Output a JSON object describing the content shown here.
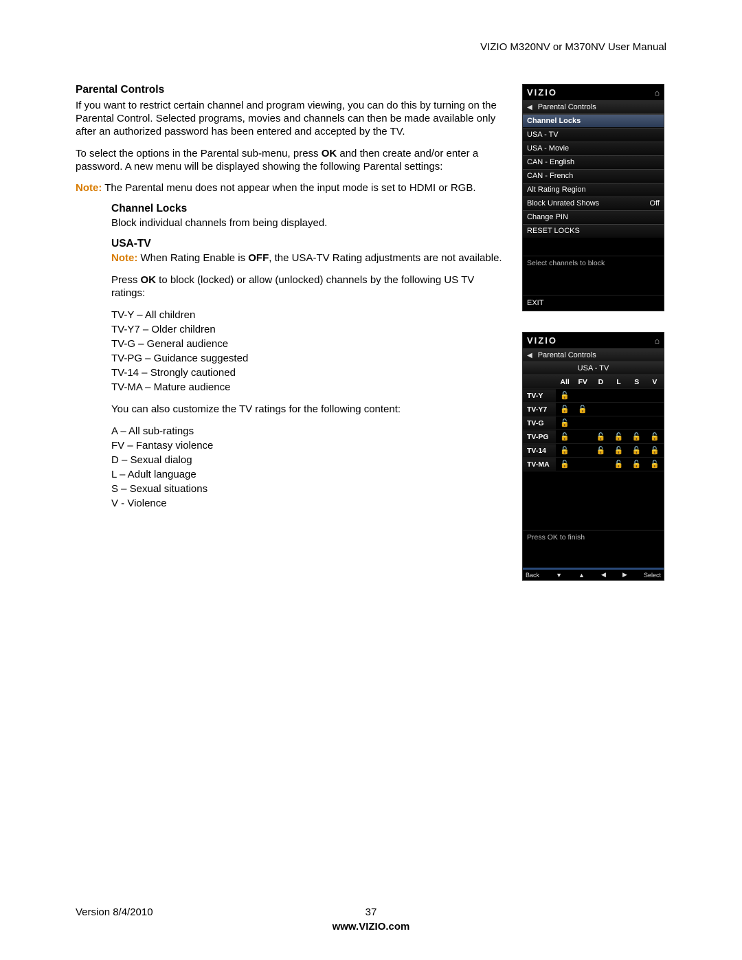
{
  "header": {
    "right": "VIZIO M320NV or M370NV User Manual"
  },
  "sections": {
    "title": "Parental Controls",
    "intro": "If you want to restrict certain channel and program viewing, you can do this by turning on the Parental Control. Selected programs, movies and channels can then be made available only after an authorized password has been entered and accepted by the TV.",
    "p2a": "To select the options in the Parental sub-menu, press ",
    "p2b": " and then create and/or enter a password. A new menu will be displayed showing the following Parental settings:",
    "ok_label": "OK",
    "note_label": "Note:",
    "note1": " The Parental menu does not appear when the input mode is set to HDMI or RGB.",
    "channel_locks_title": "Channel Locks",
    "channel_locks_body": "Block individual channels from being displayed.",
    "usa_tv_title": "USA-TV",
    "usa_note_a": " When Rating Enable is ",
    "off_label": "OFF",
    "usa_note_b": ", the USA-TV Rating adjustments are not available.",
    "usa_p1a": "Press ",
    "usa_p1b": " to block (locked) or allow (unlocked) channels by the following US TV ratings:",
    "ratings_list": [
      "TV-Y – All children",
      "TV-Y7 – Older children",
      "TV-G – General audience",
      "TV-PG – Guidance suggested",
      "TV-14 – Strongly cautioned",
      "TV-MA – Mature audience"
    ],
    "custom_intro": "You can also customize the TV ratings for the following content:",
    "content_list": [
      "A – All sub-ratings",
      "FV – Fantasy violence",
      "D – Sexual dialog",
      "L – Adult language",
      "S – Sexual situations",
      "V - Violence"
    ]
  },
  "osd1": {
    "logo": "VIZIO",
    "crumb": "Parental Controls",
    "selected": "Channel Locks",
    "items": [
      "USA - TV",
      "USA - Movie",
      "CAN - English",
      "CAN - French",
      "Alt Rating Region"
    ],
    "block_unrated": {
      "label": "Block Unrated Shows",
      "value": "Off"
    },
    "items2": [
      "Change PIN",
      "RESET LOCKS"
    ],
    "hint": "Select channels to block",
    "exit": "EXIT"
  },
  "osd2": {
    "logo": "VIZIO",
    "crumb": "Parental Controls",
    "tab": "USA - TV",
    "cols": [
      "All",
      "FV",
      "D",
      "L",
      "S",
      "V"
    ],
    "rows": [
      "TV-Y",
      "TV-Y7",
      "TV-G",
      "TV-PG",
      "TV-14",
      "TV-MA"
    ],
    "locks": [
      [
        1,
        0,
        0,
        0,
        0,
        0
      ],
      [
        1,
        1,
        0,
        0,
        0,
        0
      ],
      [
        1,
        0,
        0,
        0,
        0,
        0
      ],
      [
        1,
        0,
        1,
        1,
        1,
        1
      ],
      [
        1,
        0,
        1,
        1,
        1,
        1
      ],
      [
        1,
        0,
        0,
        1,
        1,
        1
      ]
    ],
    "hint": "Press OK to finish",
    "nav": {
      "back": "Back",
      "select": "Select"
    }
  },
  "footer": {
    "version": "Version 8/4/2010",
    "page": "37",
    "url": "www.VIZIO.com"
  }
}
